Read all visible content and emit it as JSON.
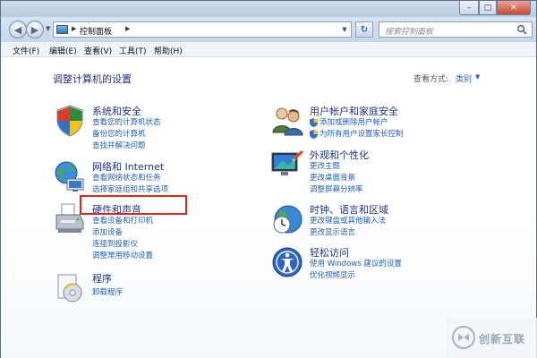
{
  "window": {
    "buttons": {
      "minimize": "–",
      "maximize": "□",
      "close": "✕"
    }
  },
  "nav": {
    "back_glyph": "◀",
    "forward_glyph": "▶",
    "address": {
      "separator": "▶",
      "crumb": "控制面板",
      "separator2": "▶"
    },
    "refresh_glyph": "↻",
    "search_placeholder": "搜索控制面板"
  },
  "menu": [
    {
      "label": "文件(F)"
    },
    {
      "label": "编辑(E)"
    },
    {
      "label": "查看(V)"
    },
    {
      "label": "工具(T)"
    },
    {
      "label": "帮助(H)"
    }
  ],
  "content": {
    "title": "调整计算机的设置",
    "view_by_label": "查看方式:",
    "view_by_value": "类别",
    "categories": [
      {
        "title": "系统和安全",
        "icon": "shield-system-icon",
        "links": [
          "查看您的计算机状态",
          "备份您的计算机",
          "查找并解决问题"
        ]
      },
      {
        "title": "网络和 Internet",
        "icon": "network-globe-icon",
        "links": [
          "查看网络状态和任务",
          "选择家庭组和共享选项"
        ]
      },
      {
        "title": "硬件和声音",
        "icon": "printer-icon",
        "links": [
          "查看设备和打印机",
          "添加设备",
          "连接到投影仪",
          "调整常用移动设置"
        ]
      },
      {
        "title": "程序",
        "icon": "program-disc-icon",
        "links": [
          "卸载程序"
        ]
      },
      {
        "title": "用户帐户和家庭安全",
        "icon": "users-icon",
        "links": [
          "添加或删除用户帐户",
          "为所有用户设置家长控制"
        ]
      },
      {
        "title": "外观和个性化",
        "icon": "monitor-paint-icon",
        "links": [
          "更改主题",
          "更改桌面背景",
          "调整屏幕分辨率"
        ]
      },
      {
        "title": "时钟、语言和区域",
        "icon": "clock-globe-icon",
        "links": [
          "更改键盘或其他输入法",
          "更改显示语言"
        ]
      },
      {
        "title": "轻松访问",
        "icon": "accessibility-icon",
        "links": [
          "使用 Windows 建议的设置",
          "优化视频显示"
        ]
      }
    ]
  },
  "watermark": {
    "text": "创新互联"
  },
  "colors": {
    "link": "#1f5fbf",
    "heading": "#1e3287",
    "highlight": "#e0261c"
  }
}
